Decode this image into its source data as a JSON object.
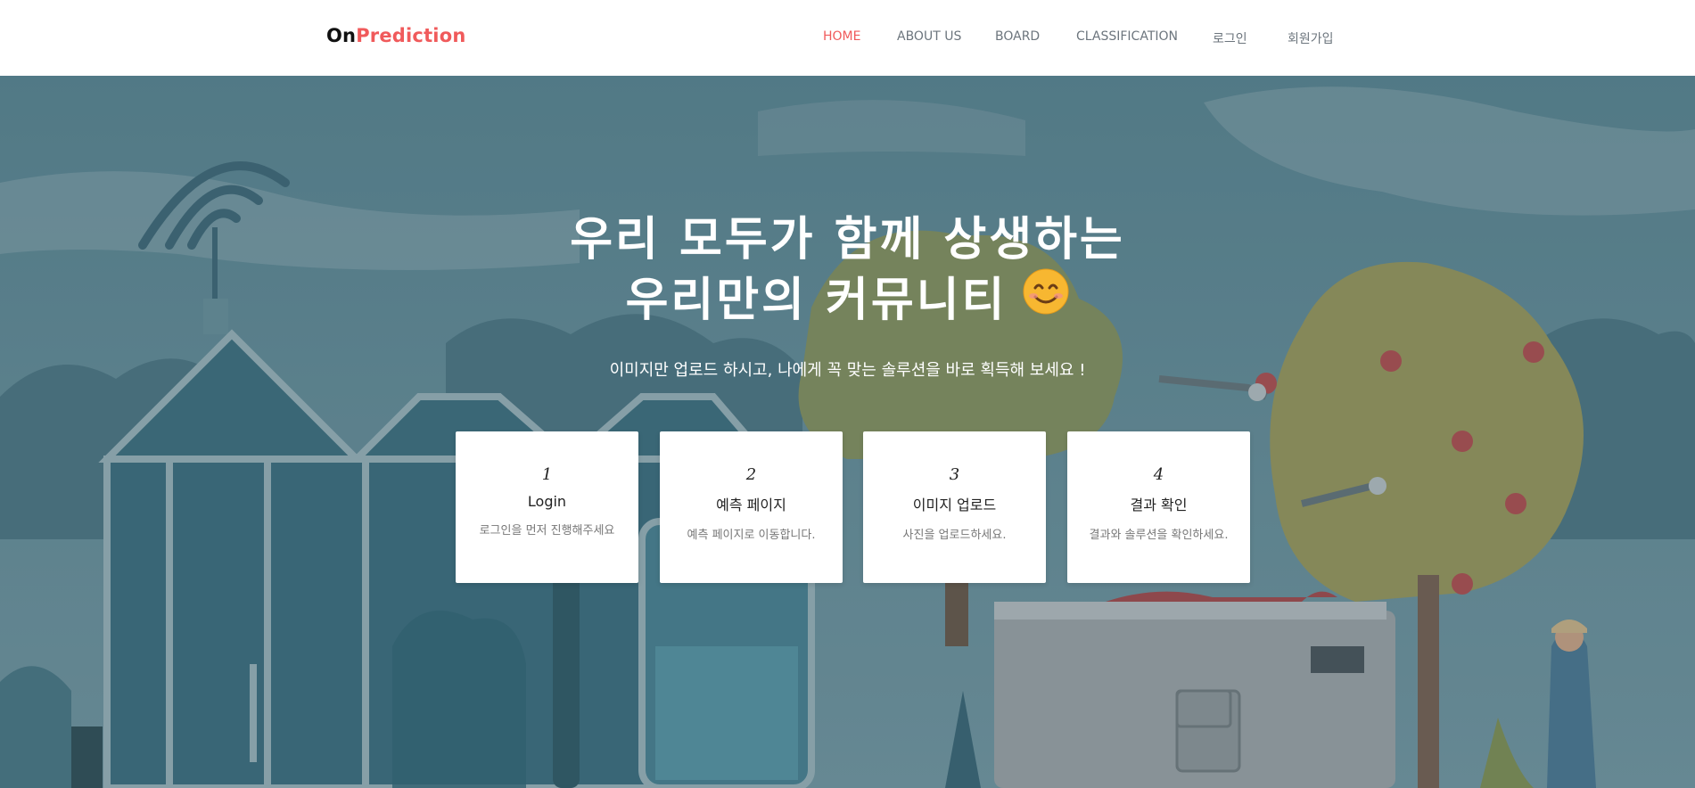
{
  "brand": {
    "part1": "On",
    "part2": "Prediction"
  },
  "nav": {
    "items": [
      {
        "label": "HOME",
        "active": true
      },
      {
        "label": "ABOUT US",
        "active": false
      },
      {
        "label": "BOARD",
        "active": false
      },
      {
        "label": "CLASSIFICATION",
        "active": false
      },
      {
        "label": "로그인",
        "active": false
      },
      {
        "label": "회원가입",
        "active": false
      }
    ]
  },
  "hero": {
    "headline_line1": "우리 모두가 함께 상생하는",
    "headline_line2": "우리만의 커뮤니티",
    "emoji": "smiling-face-icon",
    "subline": "이미지만 업로드 하시고, 나에게 꼭 맞는 솔루션을 바로 획득해 보세요 !"
  },
  "steps": [
    {
      "num": "1",
      "title": "Login",
      "desc": "로그인을 먼저 진행해주세요"
    },
    {
      "num": "2",
      "title": "예측 페이지",
      "desc": "예측 페이지로 이동합니다."
    },
    {
      "num": "3",
      "title": "이미지 업로드",
      "desc": "사진을 업로드하세요."
    },
    {
      "num": "4",
      "title": "결과 확인",
      "desc": "결과와 솔루션을 확인하세요."
    }
  ],
  "colors": {
    "accent": "#f05a5b",
    "nav_text": "#6c757d",
    "hero_sky": "#6a95a3"
  }
}
